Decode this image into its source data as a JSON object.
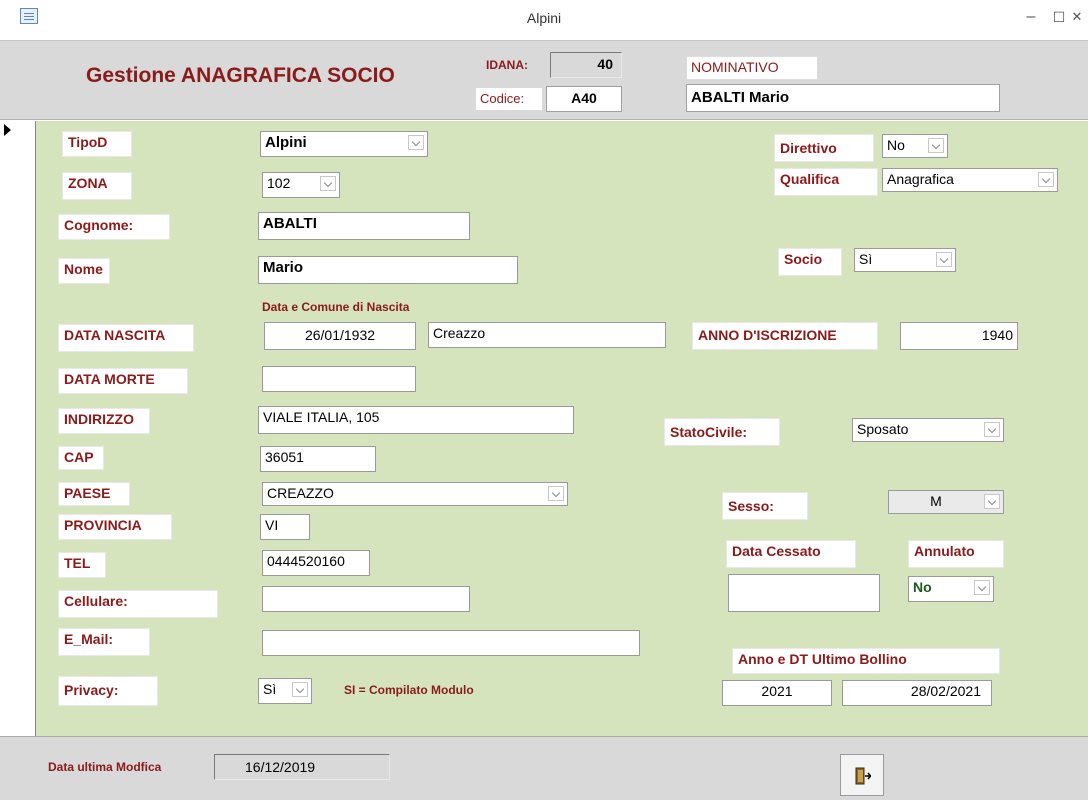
{
  "window": {
    "title": "Alpini",
    "min": "–",
    "max": "☐",
    "close": "✕"
  },
  "header": {
    "title": "Gestione ANAGRAFICA SOCIO",
    "idana_label": "IDANA:",
    "idana_value": "40",
    "codice_label": "Codice:",
    "codice_value": "A40",
    "nominativo_label": "NOMINATIVO",
    "nominativo_value": "ABALTI Mario"
  },
  "form": {
    "tipo_label": "TipoD",
    "tipo_value": "Alpini",
    "zona_label": "ZONA",
    "zona_value": "102",
    "cognome_label": "Cognome:",
    "cognome_value": "ABALTI",
    "nome_label": "Nome",
    "nome_value": "Mario",
    "nascita_note": "Data   e   Comune  di Nascita",
    "data_nascita_label": "DATA NASCITA",
    "data_nascita_value": "26/01/1932",
    "comune_nascita_value": "Creazzo",
    "data_morte_label": "DATA MORTE",
    "data_morte_value": "",
    "indirizzo_label": "INDIRIZZO",
    "indirizzo_value": "VIALE ITALIA, 105",
    "cap_label": "CAP",
    "cap_value": "36051",
    "paese_label": "PAESE",
    "paese_value": "CREAZZO",
    "provincia_label": "PROVINCIA",
    "provincia_value": "VI",
    "tel_label": "TEL",
    "tel_value": "0444520160",
    "cellulare_label": "Cellulare:",
    "cellulare_value": "",
    "email_label": "E_Mail:",
    "email_value": "",
    "privacy_label": "Privacy:",
    "privacy_value": "Sì",
    "privacy_note": "SI =  Compilato Modulo",
    "direttivo_label": "Direttivo",
    "direttivo_value": "No",
    "qualifica_label": "Qualifica",
    "qualifica_value": "Anagrafica",
    "socio_label": "Socio",
    "socio_value": "Sì",
    "anno_iscrizione_label": "ANNO D'ISCRIZIONE",
    "anno_iscrizione_value": "1940",
    "stato_civile_label": "StatoCivile:",
    "stato_civile_value": "Sposato",
    "sesso_label": "Sesso:",
    "sesso_value": "M",
    "data_cessato_label": "Data Cessato",
    "data_cessato_value": "",
    "annulato_label": "Annulato",
    "annulato_value": "No",
    "bollino_label": "Anno e DT Ultimo Bollino",
    "bollino_anno": "2021",
    "bollino_data": "28/02/2021"
  },
  "footer": {
    "modifica_label": "Data ultima Modfica",
    "modifica_value": "16/12/2019",
    "exit_icon": "exit-door-icon"
  }
}
